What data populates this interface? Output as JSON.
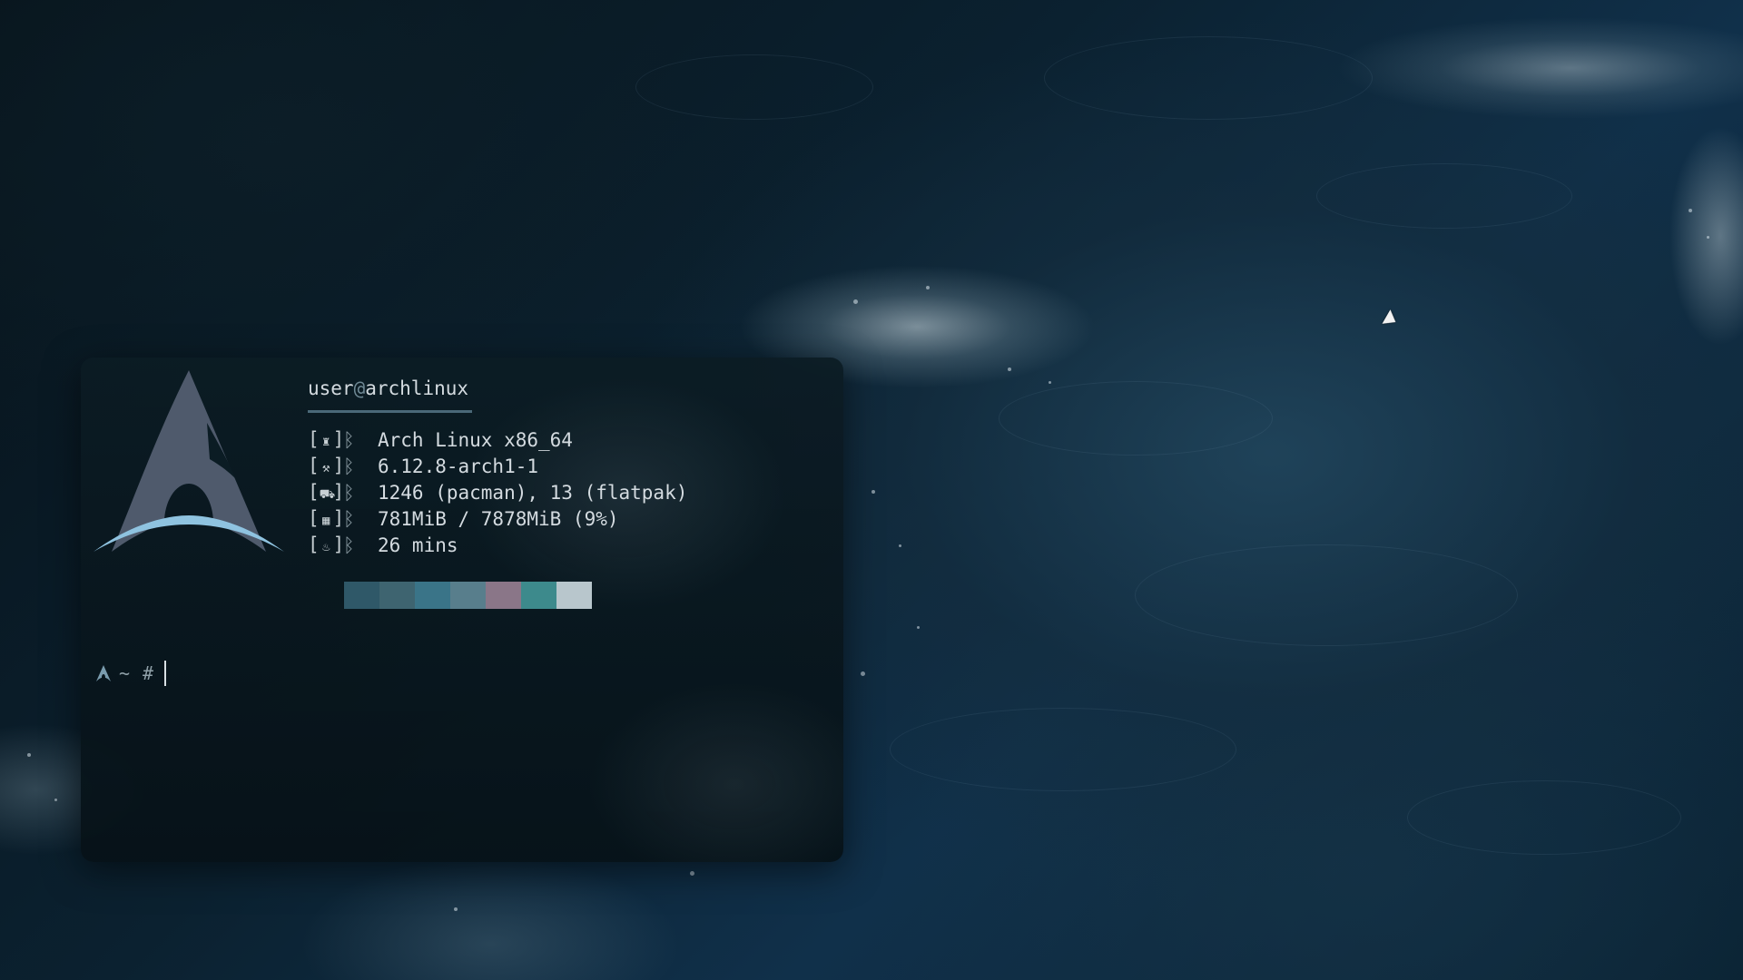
{
  "desktop": {
    "wallpaper": "ocean-waves"
  },
  "terminal": {
    "user": "user",
    "at": "@",
    "host": "archlinux",
    "info": [
      {
        "icon": "os-icon",
        "glyph": "♜",
        "sep": "ᛒ",
        "value": "Arch Linux x86_64"
      },
      {
        "icon": "kernel-icon",
        "glyph": "⚒",
        "sep": "ᛒ",
        "value": "6.12.8-arch1-1"
      },
      {
        "icon": "packages-icon",
        "glyph": "⛟",
        "sep": "ᛒ",
        "value": "1246 (pacman), 13 (flatpak)"
      },
      {
        "icon": "memory-icon",
        "glyph": "▦",
        "sep": "ᛒ",
        "value": "781MiB / 7878MiB (9%)"
      },
      {
        "icon": "uptime-icon",
        "glyph": "♨",
        "sep": "ᛒ",
        "value": "26 mins"
      }
    ],
    "palette": [
      "#2f5868",
      "#3e6470",
      "#3a7488",
      "#587e8c",
      "#8a7688",
      "#3d8a8c",
      "#b8c6cc"
    ],
    "prompt": {
      "tilde": "~",
      "hash": "#"
    }
  },
  "colors": {
    "arch_logo": "#4f5a6c",
    "arch_swoosh": "#8fc3e0",
    "accent": "#4a6878"
  }
}
